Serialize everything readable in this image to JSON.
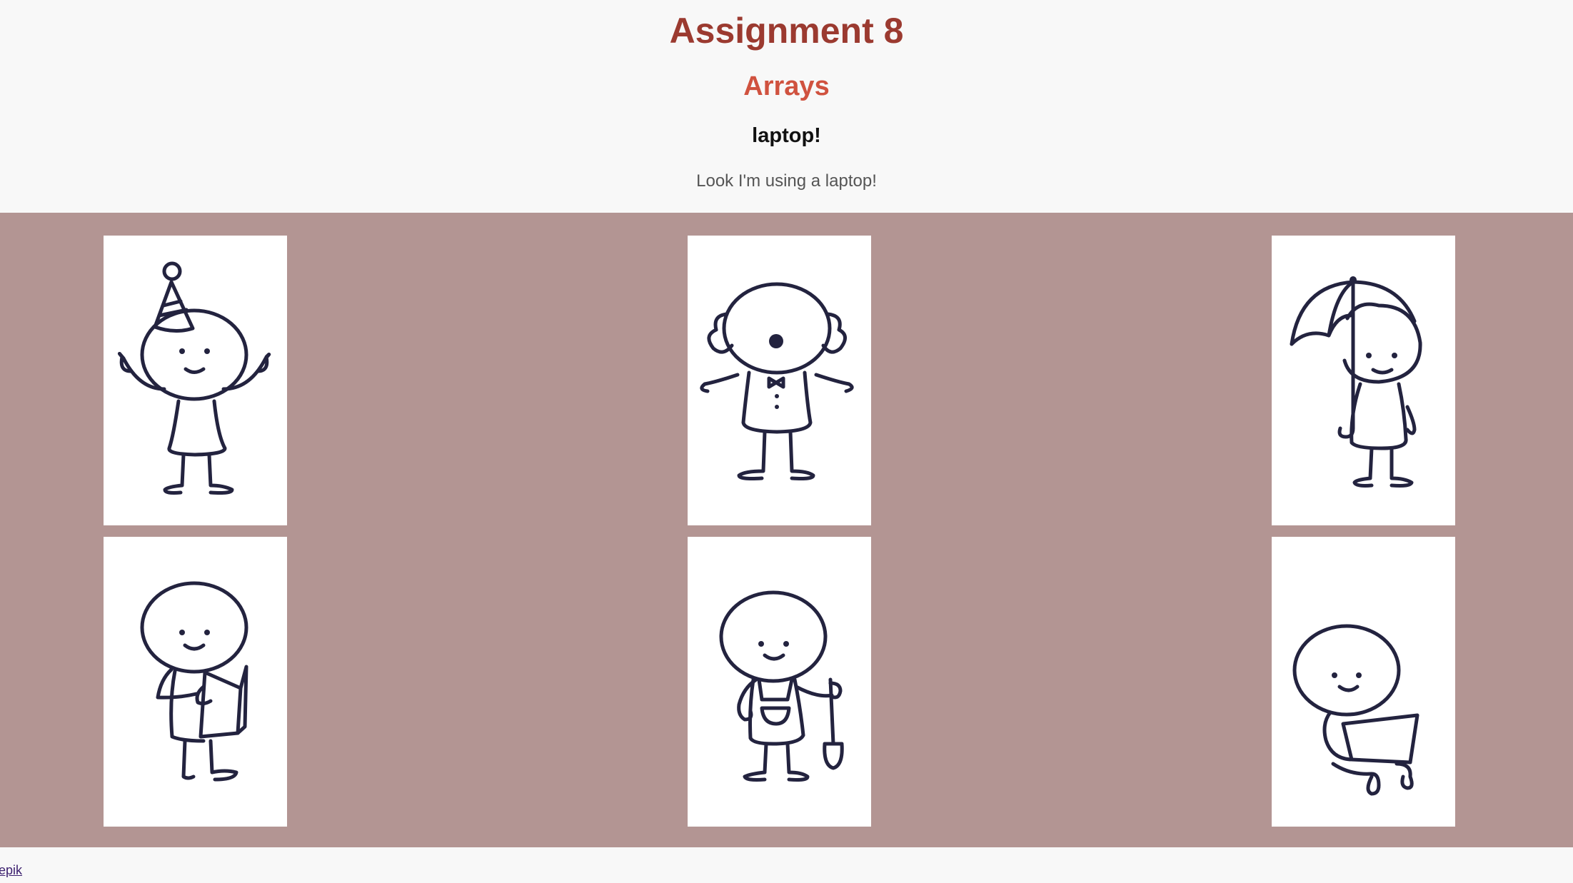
{
  "header": {
    "title": "Assignment 8",
    "subtitle": "Arrays",
    "caption_title": "laptop!",
    "caption_text": "Look I'm using a laptop!"
  },
  "gallery": {
    "background_color": "#b39593",
    "items": [
      {
        "icon": "party-hat-figure-icon"
      },
      {
        "icon": "clown-figure-icon"
      },
      {
        "icon": "umbrella-figure-icon"
      },
      {
        "icon": "book-reading-figure-icon"
      },
      {
        "icon": "gardener-shovel-figure-icon"
      },
      {
        "icon": "laptop-figure-icon"
      }
    ]
  },
  "footer": {
    "credit_link": "eepik"
  },
  "colors": {
    "title": "#9b3a30",
    "subtitle": "#d0523f",
    "ink": "#23233f"
  }
}
